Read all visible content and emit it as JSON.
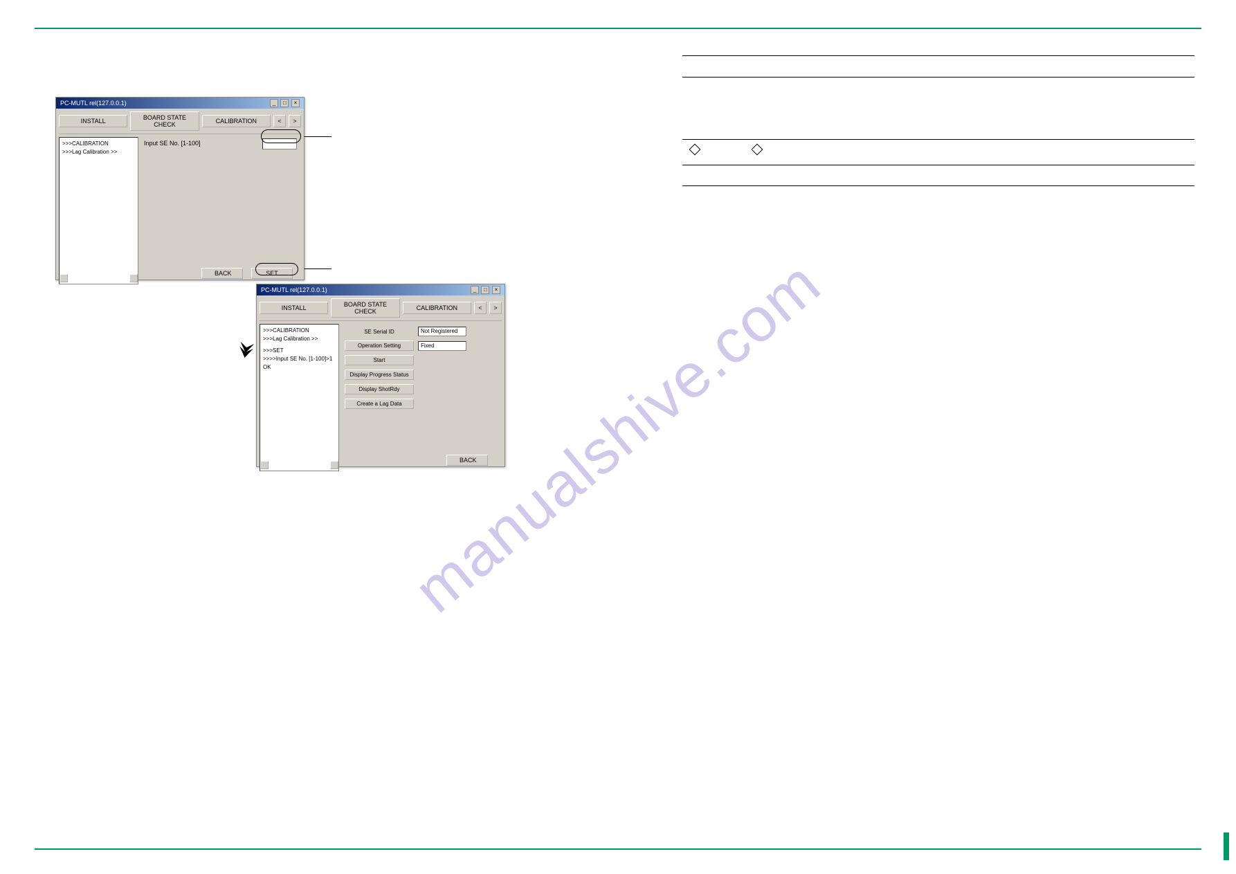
{
  "watermark": "manualshive.com",
  "window": {
    "title": "PC-MUTL rel(127.0.0.1)",
    "tabs": {
      "install": "INSTALL",
      "board_state": "BOARD STATE CHECK",
      "calibration": "CALIBRATION",
      "prev": "<",
      "next": ">"
    },
    "win1": {
      "sidebar": {
        "l1": ">>>CALIBRATION",
        "l2": ">>>Lag Calibration >>"
      },
      "label_input": "Input SE No. [1-100]",
      "btn_back": "BACK",
      "btn_set": "SET"
    },
    "win2": {
      "sidebar": {
        "l1": ">>>CALIBRATION",
        "l2": ">>>Lag Calibration >>",
        "l3": ">>>SET",
        "l4": ">>>>Input SE No. [1-100]>1",
        "l5": "OK"
      },
      "rows": {
        "se_serial_label": "SE Serial ID",
        "se_serial_val": "Not Registered",
        "op_setting_label": "Operation Setting",
        "op_setting_val": "Fixed",
        "start": "Start",
        "display_progress": "Display Progress Status",
        "display_shotrdy": "Display ShotRdy",
        "create_lag": "Create a Lag Data"
      },
      "btn_back": "BACK"
    }
  },
  "table": {
    "blank": ""
  }
}
